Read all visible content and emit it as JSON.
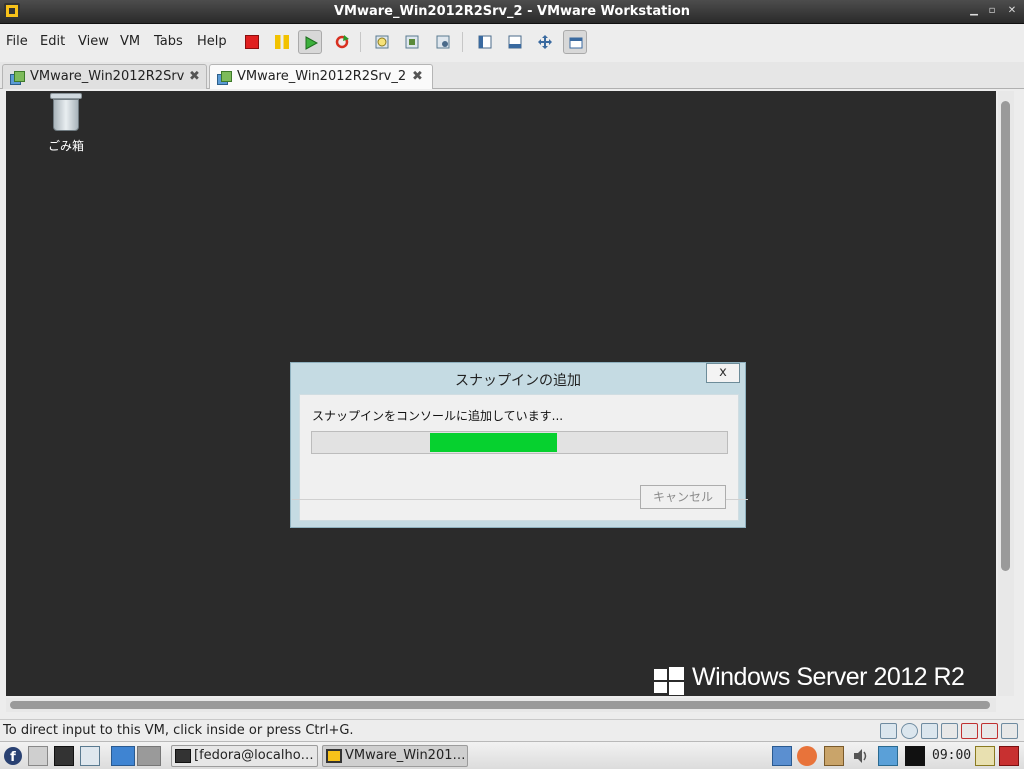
{
  "window": {
    "title": "VMware_Win2012R2Srv_2 - VMware Workstation"
  },
  "menu": [
    "File",
    "Edit",
    "View",
    "VM",
    "Tabs",
    "Help"
  ],
  "tabs": [
    {
      "label": "VMware_Win2012R2Srv",
      "active": false
    },
    {
      "label": "VMware_Win2012R2Srv_2",
      "active": true
    }
  ],
  "desktop": {
    "recycle_bin_label": "ごみ箱",
    "branding": "Windows Server 2012 R2"
  },
  "dialog": {
    "title": "スナップインの追加",
    "close_label": "x",
    "message": "スナップインをコンソールに追加しています...",
    "cancel_label": "キャンセル",
    "progress": {
      "start_fraction": 0.285,
      "end_fraction": 0.59
    }
  },
  "status": {
    "message": "To direct input to this VM, click inside or press Ctrl+G."
  },
  "taskbar": {
    "items": [
      {
        "label": "[fedora@localho…",
        "active": false
      },
      {
        "label": "VMware_Win201…",
        "active": true
      }
    ],
    "clock": "09:00"
  },
  "colors": {
    "progress": "#06d12f",
    "vm_background": "#2b2b2b",
    "dialog_frame": "#c5dbe3"
  }
}
